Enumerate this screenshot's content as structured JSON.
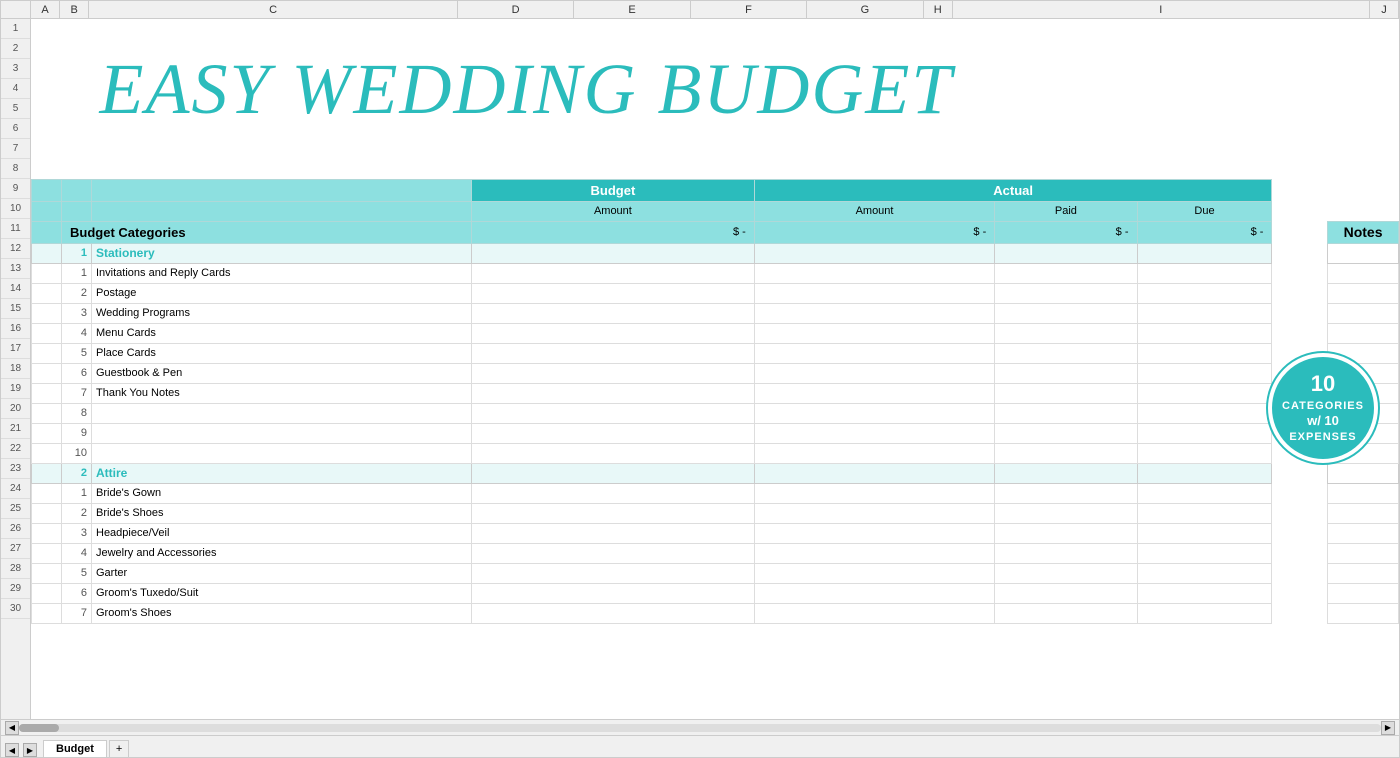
{
  "title": "EASY WEDDING BUDGET",
  "sheet": {
    "tab_name": "Budget",
    "tab_add": "+",
    "columns": [
      "A",
      "B",
      "C",
      "D",
      "E",
      "F",
      "G",
      "H",
      "I",
      "J"
    ],
    "header": {
      "row9": {
        "budget_label": "Budget",
        "actual_label": "Actual"
      },
      "row10": {
        "amount": "Amount",
        "amount2": "Amount",
        "paid": "Paid",
        "due": "Due"
      },
      "row11": {
        "categories": "Budget Categories",
        "budget_val": "$ -",
        "actual_val": "$ -",
        "paid_val": "$ -",
        "due_val": "$ -",
        "notes": "Notes"
      }
    },
    "categories": [
      {
        "num": "1",
        "name": "Stationery",
        "items": [
          {
            "num": "1",
            "name": "Invitations and Reply Cards"
          },
          {
            "num": "2",
            "name": "Postage"
          },
          {
            "num": "3",
            "name": "Wedding Programs"
          },
          {
            "num": "4",
            "name": "Menu Cards"
          },
          {
            "num": "5",
            "name": "Place Cards"
          },
          {
            "num": "6",
            "name": "Guestbook & Pen"
          },
          {
            "num": "7",
            "name": "Thank You Notes"
          },
          {
            "num": "8",
            "name": ""
          },
          {
            "num": "9",
            "name": ""
          },
          {
            "num": "10",
            "name": ""
          }
        ]
      },
      {
        "num": "2",
        "name": "Attire",
        "items": [
          {
            "num": "1",
            "name": "Bride's Gown"
          },
          {
            "num": "2",
            "name": "Bride's Shoes"
          },
          {
            "num": "3",
            "name": "Headpiece/Veil"
          },
          {
            "num": "4",
            "name": "Jewelry and Accessories"
          },
          {
            "num": "5",
            "name": "Garter"
          },
          {
            "num": "6",
            "name": "Groom's Tuxedo/Suit"
          },
          {
            "num": "7",
            "name": "Groom's Shoes"
          }
        ]
      }
    ],
    "badge": {
      "line1": "10",
      "line2": "CATEGORIES",
      "line3": "w/ 10",
      "line4": "EXPENSES"
    }
  }
}
